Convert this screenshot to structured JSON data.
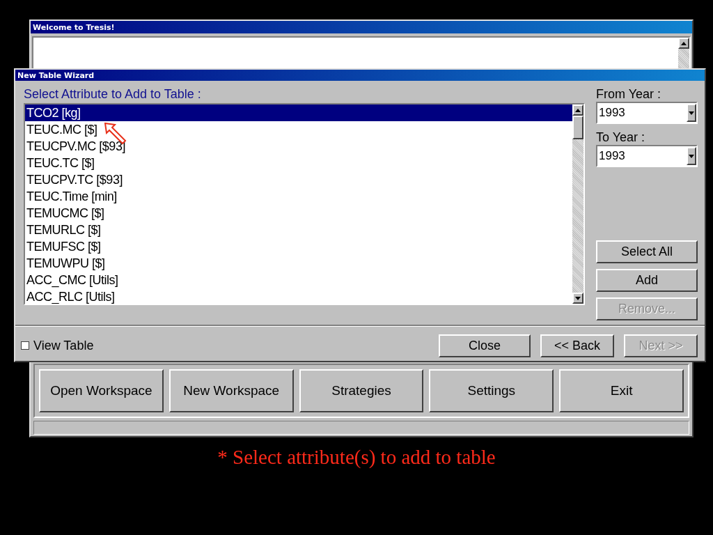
{
  "background_window": {
    "title": "Welcome to Tresis!",
    "buttons": [
      {
        "label": "Open Workspace"
      },
      {
        "label": "New Workspace"
      },
      {
        "label": "Strategies"
      },
      {
        "label": "Settings"
      },
      {
        "label": "Exit"
      }
    ]
  },
  "dialog": {
    "title": "New Table Wizard",
    "list_label": "Select Attribute to Add to Table :",
    "attributes": [
      {
        "label": "TCO2 [kg]",
        "selected": true
      },
      {
        "label": "TEUC.MC [$]",
        "selected": false
      },
      {
        "label": "TEUCPV.MC [$93]",
        "selected": false
      },
      {
        "label": "TEUC.TC [$]",
        "selected": false
      },
      {
        "label": "TEUCPV.TC [$93]",
        "selected": false
      },
      {
        "label": "TEUC.Time [min]",
        "selected": false
      },
      {
        "label": "TEMUCMC [$]",
        "selected": false
      },
      {
        "label": "TEMURLC [$]",
        "selected": false
      },
      {
        "label": "TEMUFSC [$]",
        "selected": false
      },
      {
        "label": "TEMUWPU [$]",
        "selected": false
      },
      {
        "label": "ACC_CMC [Utils]",
        "selected": false
      },
      {
        "label": "ACC_RLC [Utils]",
        "selected": false
      }
    ],
    "from_year": {
      "label": "From Year :",
      "value": "1993"
    },
    "to_year": {
      "label": "To Year :",
      "value": "1993"
    },
    "side_buttons": [
      {
        "label": "Select All",
        "disabled": false
      },
      {
        "label": "Add",
        "disabled": false
      },
      {
        "label": "Remove...",
        "disabled": true
      }
    ],
    "view_table": {
      "label": "View Table",
      "checked": false
    },
    "nav_buttons": [
      {
        "label": "Close",
        "disabled": false
      },
      {
        "label": "<< Back",
        "disabled": false
      },
      {
        "label": "Next >>",
        "disabled": true
      }
    ]
  },
  "caption": "* Select attribute(s) to add to table"
}
